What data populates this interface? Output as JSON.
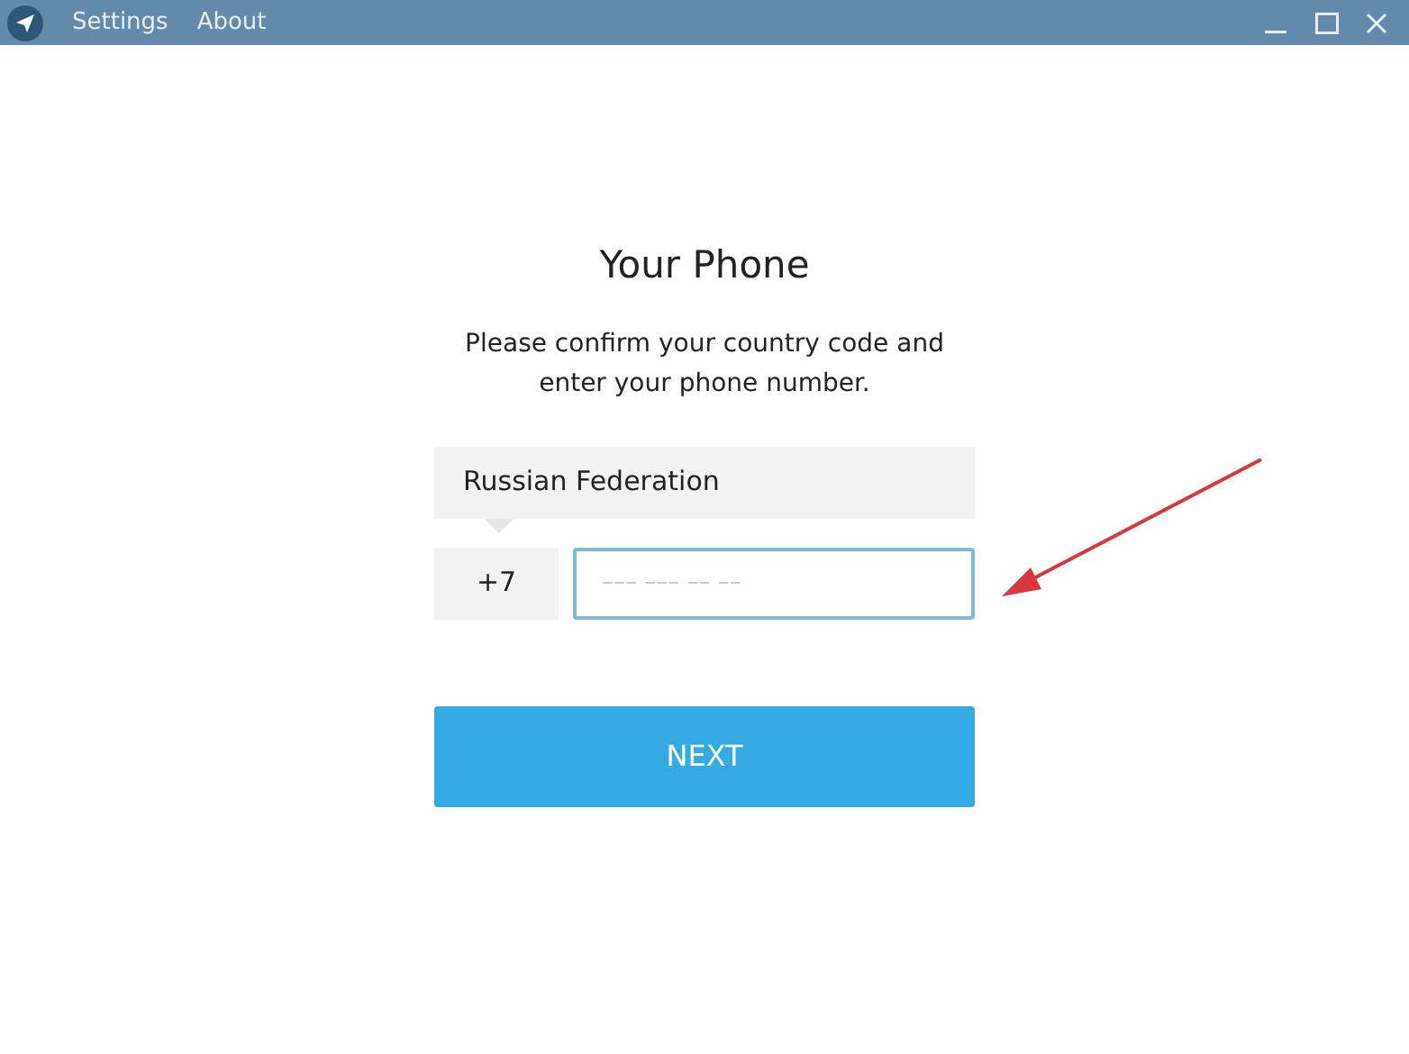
{
  "window": {
    "menu": [
      "Settings",
      "About"
    ]
  },
  "heading": "Your Phone",
  "description": "Please confirm your country code and enter your phone number.",
  "country": "Russian Federation",
  "code": "+7",
  "phone": {
    "placeholder": "––– ––– –– ––",
    "focused": true
  },
  "button": "NEXT"
}
